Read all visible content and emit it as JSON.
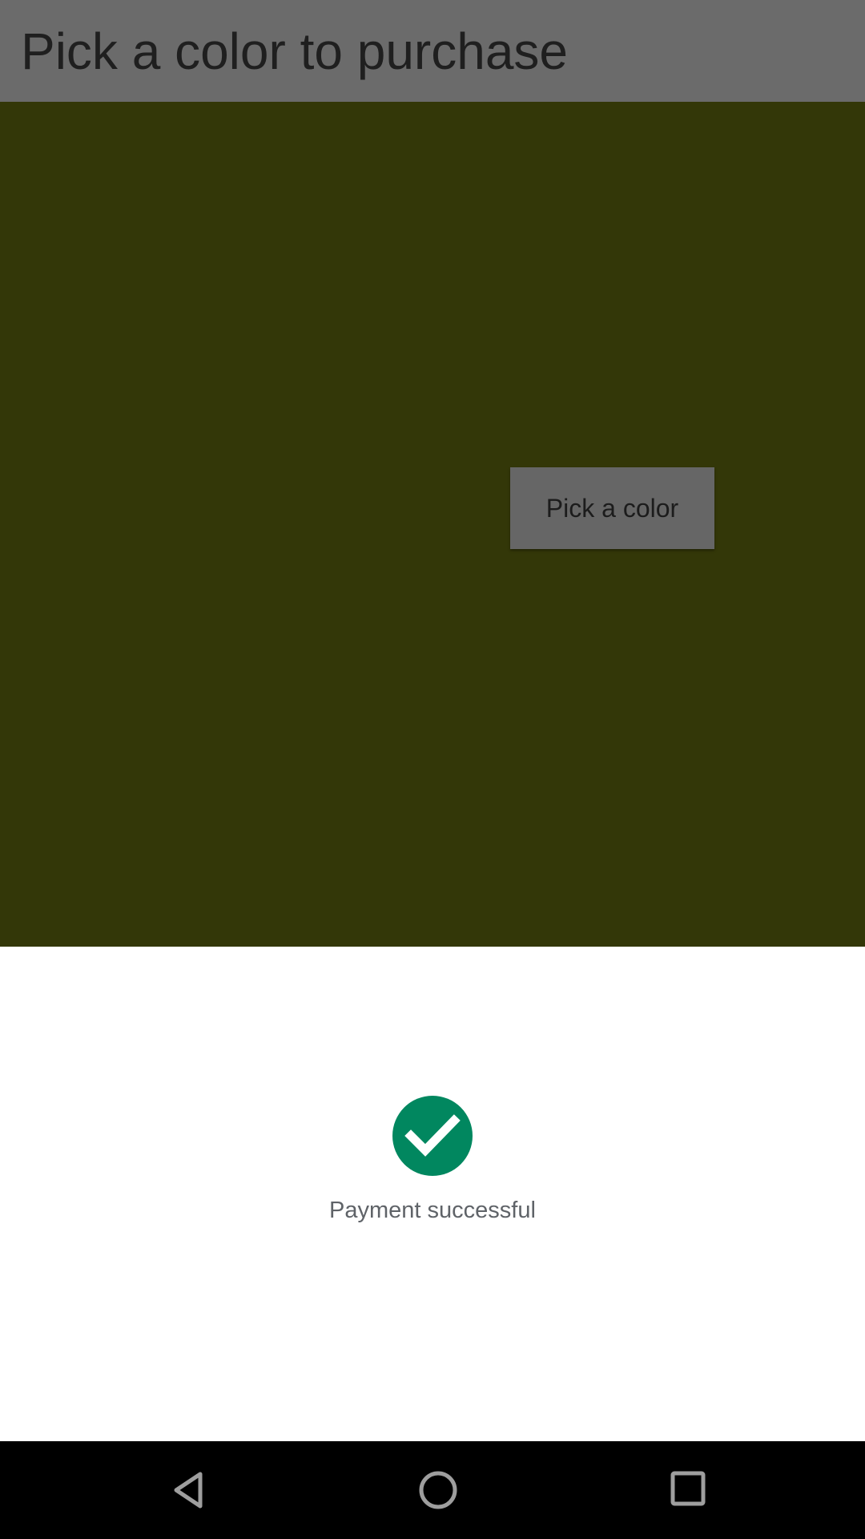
{
  "app_bar": {
    "title": "Pick a color to purchase"
  },
  "content": {
    "background_color": "#333708",
    "pick_button_label": "Pick a color"
  },
  "payment_sheet": {
    "status_icon": "check-circle-icon",
    "status_icon_color": "#01875f",
    "status_text": "Payment successful"
  },
  "nav_bar": {
    "back_icon": "back-triangle-icon",
    "home_icon": "home-circle-icon",
    "recents_icon": "recents-square-icon"
  }
}
